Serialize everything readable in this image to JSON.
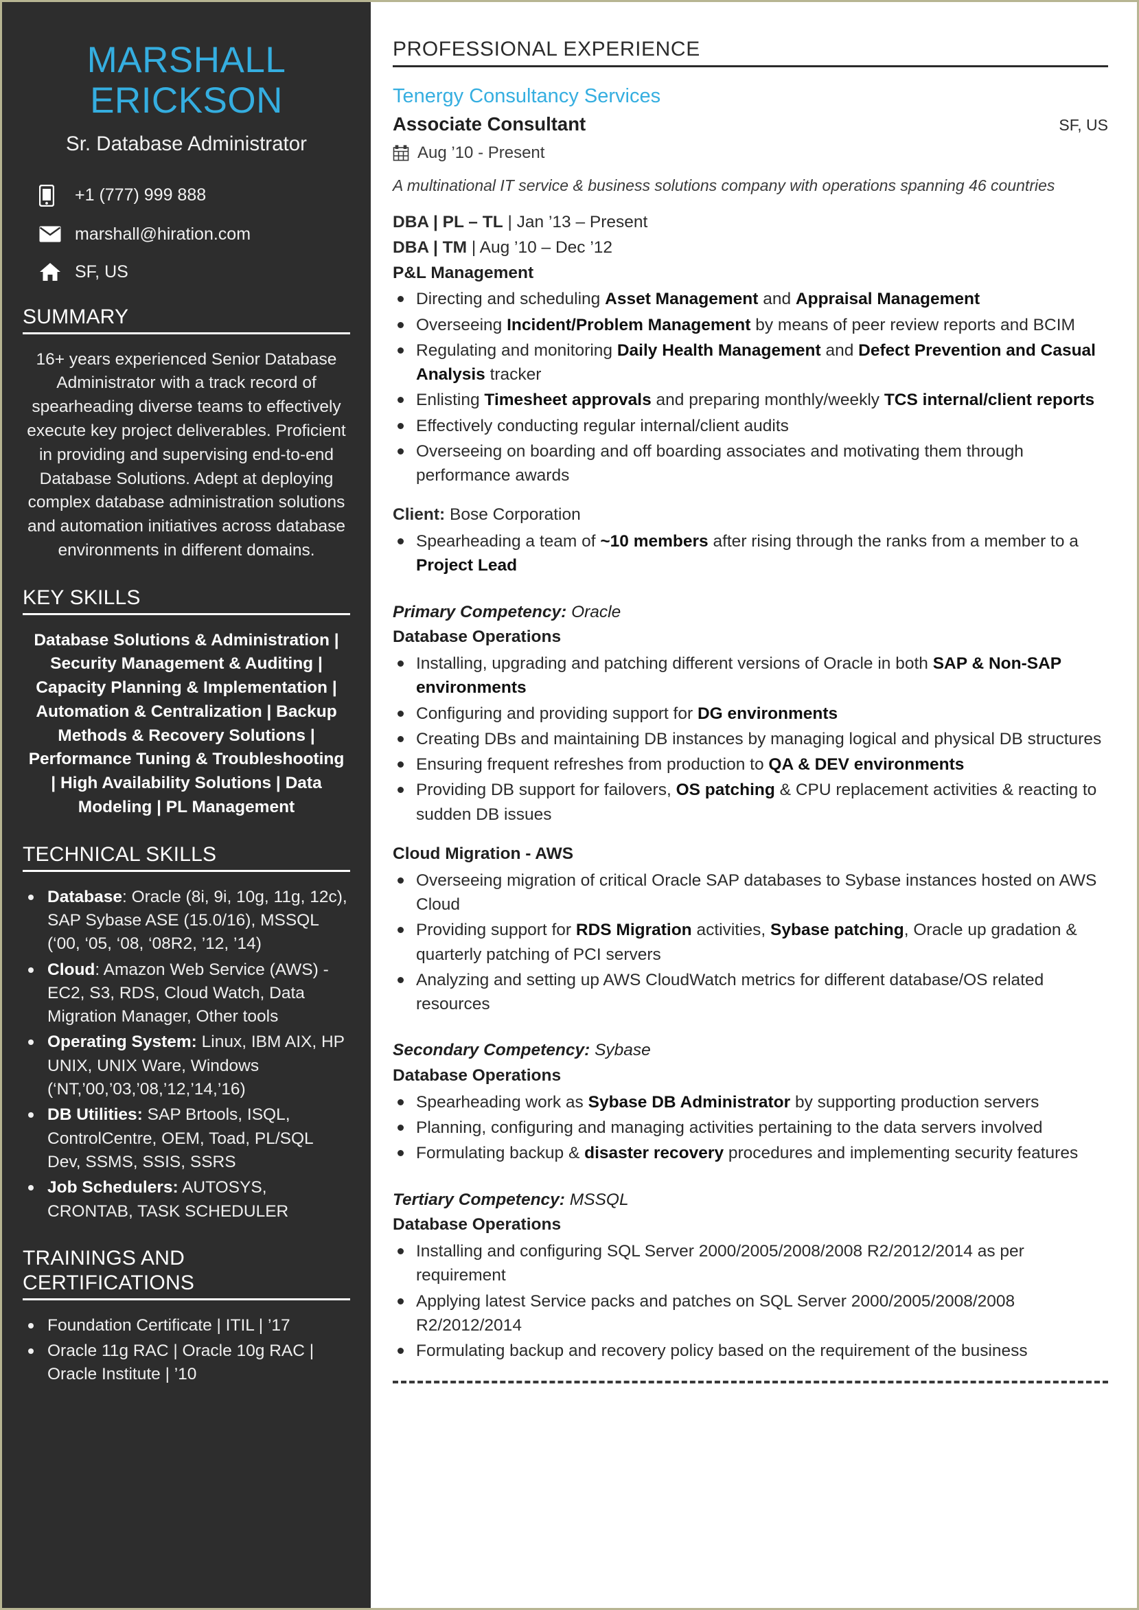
{
  "sidebar": {
    "name_first": "MARSHALL",
    "name_last": "ERICKSON",
    "job_title": "Sr. Database Administrator",
    "contact": {
      "phone": "+1 (777) 999 888",
      "email": "marshall@hiration.com",
      "location": "SF, US",
      "phone_icon": "mobile-phone-icon",
      "email_icon": "envelope-icon",
      "location_icon": "home-icon"
    },
    "summary_heading": "SUMMARY",
    "summary_text": "16+ years experienced Senior Database Administrator with a track record of spearheading diverse teams to effectively execute key project deliverables. Proficient in providing and supervising end-to-end Database Solutions. Adept at deploying complex database administration solutions and automation initiatives across database environments in different domains.",
    "key_skills_heading": "KEY SKILLS",
    "key_skills_text": "Database Solutions & Administration | Security Management & Auditing | Capacity Planning & Implementation | Automation & Centralization | Backup Methods & Recovery Solutions | Performance Tuning & Troubleshooting | High Availability Solutions | Data Modeling | PL Management",
    "technical_skills_heading": "TECHNICAL SKILLS",
    "technical_skills": [
      {
        "label": "Database",
        "sep": ": ",
        "value": "Oracle (8i, 9i, 10g, 11g, 12c), SAP Sybase ASE (15.0/16), MSSQL (‘00, ‘05, ‘08, ‘08R2, ’12, ’14)"
      },
      {
        "label": "Cloud",
        "sep": ": ",
        "value": "Amazon Web Service (AWS) - EC2, S3, RDS, Cloud Watch, Data Migration Manager, Other tools"
      },
      {
        "label": "Operating System:",
        "sep": " ",
        "value": "Linux, IBM AIX, HP UNIX, UNIX Ware, Windows (‘NT,’00,’03,’08,’12,’14,’16)"
      },
      {
        "label": "DB Utilities:",
        "sep": "  ",
        "value": "SAP Brtools, ISQL, ControlCentre, OEM, Toad, PL/SQL Dev, SSMS, SSIS, SSRS"
      },
      {
        "label": "Job Schedulers:",
        "sep": " ",
        "value": "AUTOSYS, CRONTAB, TASK SCHEDULER"
      }
    ],
    "trainings_heading_line1": "TRAININGS AND",
    "trainings_heading_line2": "CERTIFICATIONS",
    "trainings": [
      "Foundation Certificate  | ITIL | ’17",
      "Oracle 11g RAC | Oracle 10g RAC | Oracle Institute | ’10"
    ]
  },
  "main": {
    "section_heading": "PROFESSIONAL EXPERIENCE",
    "company": "Tenergy Consultancy Services",
    "role_title": "Associate Consultant",
    "role_location": "SF, US",
    "date_icon": "calendar-icon",
    "date_range": "Aug ’10  -  Present",
    "company_blurb": "A multinational IT service & business solutions company with operations spanning 46 countries",
    "role_lines": [
      {
        "bold": "DBA | PL – TL",
        "rest": " | Jan ’13 – Present"
      },
      {
        "bold": "DBA | TM",
        "rest": " | Aug ’10 – Dec ’12"
      }
    ],
    "pl_heading": "P&L Management",
    "pl_bullets": [
      [
        {
          "t": "Directing and scheduling ",
          "b": false
        },
        {
          "t": "Asset Management",
          "b": true
        },
        {
          "t": " and ",
          "b": false
        },
        {
          "t": "Appraisal Management",
          "b": true
        }
      ],
      [
        {
          "t": "Overseeing ",
          "b": false
        },
        {
          "t": "Incident/Problem Management",
          "b": true
        },
        {
          "t": " by means of peer review reports and BCIM",
          "b": false
        }
      ],
      [
        {
          "t": "Regulating and monitoring ",
          "b": false
        },
        {
          "t": "Daily Health Management",
          "b": true
        },
        {
          "t": " and ",
          "b": false
        },
        {
          "t": "Defect Prevention and Casual Analysis",
          "b": true
        },
        {
          "t": " tracker",
          "b": false
        }
      ],
      [
        {
          "t": "Enlisting ",
          "b": false
        },
        {
          "t": "Timesheet approvals",
          "b": true
        },
        {
          "t": " and preparing monthly/weekly ",
          "b": false
        },
        {
          "t": "TCS internal/client reports",
          "b": true
        }
      ],
      [
        {
          "t": "Effectively conducting regular internal/client audits",
          "b": false
        }
      ],
      [
        {
          "t": "Overseeing on boarding and off boarding associates and motivating them through performance awards",
          "b": false
        }
      ]
    ],
    "client_label": "Client:",
    "client_name": " Bose Corporation",
    "client_bullets": [
      [
        {
          "t": "Spearheading a team of ",
          "b": false
        },
        {
          "t": "~10 members",
          "b": true
        },
        {
          "t": " after rising through the ranks from a member to a ",
          "b": false
        },
        {
          "t": "Project Lead",
          "b": true
        }
      ]
    ],
    "competencies": [
      {
        "label": "Primary Competency:",
        "value": " Oracle",
        "group_heading": "Database Operations",
        "bullets": [
          [
            {
              "t": "Installing, upgrading and patching different versions of Oracle in both ",
              "b": false
            },
            {
              "t": "SAP & Non-SAP environments",
              "b": true
            }
          ],
          [
            {
              "t": "Configuring and providing support for ",
              "b": false
            },
            {
              "t": "DG environments",
              "b": true
            }
          ],
          [
            {
              "t": "Creating DBs and maintaining DB instances by managing logical and physical DB structures",
              "b": false
            }
          ],
          [
            {
              "t": "Ensuring frequent refreshes from production to ",
              "b": false
            },
            {
              "t": "QA & DEV environments",
              "b": true
            }
          ],
          [
            {
              "t": "Providing DB support for failovers, ",
              "b": false
            },
            {
              "t": "OS patching",
              "b": true
            },
            {
              "t": " & CPU replacement activities & reacting to sudden DB issues",
              "b": false
            }
          ]
        ],
        "extra_group_heading": "Cloud Migration - AWS",
        "extra_bullets": [
          [
            {
              "t": "Overseeing migration of critical Oracle SAP databases to Sybase instances hosted on AWS Cloud",
              "b": false
            }
          ],
          [
            {
              "t": "Providing support for ",
              "b": false
            },
            {
              "t": "RDS Migration",
              "b": true
            },
            {
              "t": " activities, ",
              "b": false
            },
            {
              "t": "Sybase patching",
              "b": true
            },
            {
              "t": ", Oracle up gradation & quarterly patching of PCI servers",
              "b": false
            }
          ],
          [
            {
              "t": "Analyzing and setting up AWS CloudWatch metrics for different database/OS related resources",
              "b": false
            }
          ]
        ]
      },
      {
        "label": "Secondary Competency:",
        "value": " Sybase",
        "group_heading": "Database Operations",
        "bullets": [
          [
            {
              "t": "Spearheading work as ",
              "b": false
            },
            {
              "t": "Sybase DB Administrator",
              "b": true
            },
            {
              "t": " by supporting production servers",
              "b": false
            }
          ],
          [
            {
              "t": "Planning, configuring and managing activities pertaining to the data servers involved",
              "b": false
            }
          ],
          [
            {
              "t": "Formulating backup & ",
              "b": false
            },
            {
              "t": "disaster recovery",
              "b": true
            },
            {
              "t": " procedures and implementing security features",
              "b": false
            }
          ]
        ],
        "extra_group_heading": "",
        "extra_bullets": []
      },
      {
        "label": "Tertiary Competency:",
        "value": " MSSQL",
        "group_heading": "Database Operations",
        "bullets": [
          [
            {
              "t": "Installing and configuring SQL Server 2000/2005/2008/2008 R2/2012/2014 as per requirement",
              "b": false
            }
          ],
          [
            {
              "t": "Applying latest Service packs and patches on SQL Server 2000/2005/2008/2008 R2/2012/2014",
              "b": false
            }
          ],
          [
            {
              "t": "Formulating backup and recovery policy based on the requirement of the business",
              "b": false
            }
          ]
        ],
        "extra_group_heading": "",
        "extra_bullets": []
      }
    ]
  },
  "colors": {
    "accent_blue": "#35aee0",
    "sidebar_bg": "#2d2d2d",
    "page_border": "#b7b592",
    "text_dark": "#2b2b2b"
  }
}
